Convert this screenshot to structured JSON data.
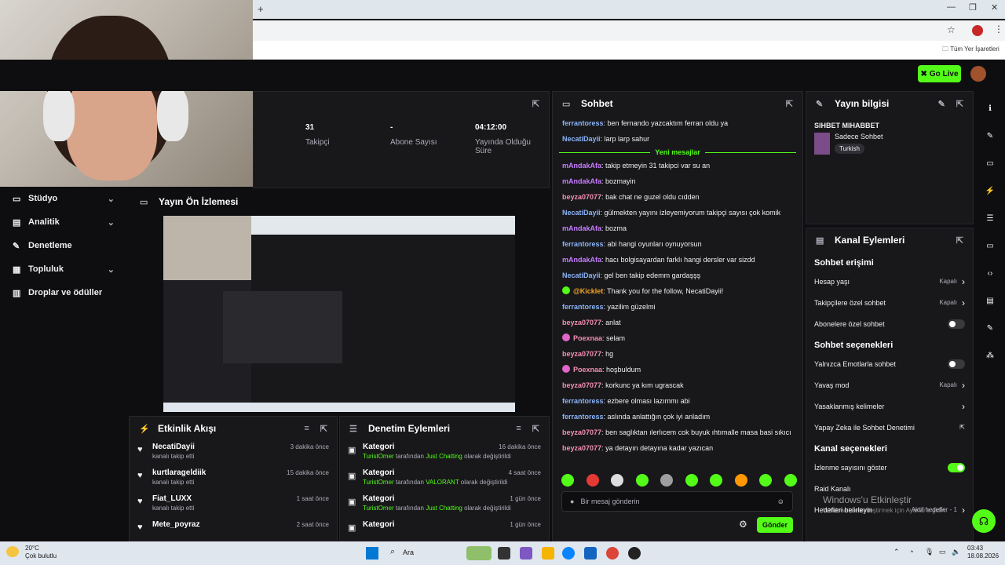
{
  "browser": {
    "new_tab": "+",
    "bookmarks_label": "Tüm Yer İşaretleri"
  },
  "header": {
    "go_live": "Go Live"
  },
  "stats": {
    "followers_value": "31",
    "followers_label": "Takipçi",
    "subs_value": "-",
    "subs_label": "Abone Sayısı",
    "uptime_value": "04:12:00",
    "uptime_label": "Yayında Olduğu Süre"
  },
  "sidebar": {
    "items": [
      {
        "label": "Stüdyo",
        "icon": "studio-icon",
        "chevron": true
      },
      {
        "label": "Analitik",
        "icon": "analytics-icon",
        "chevron": true
      },
      {
        "label": "Denetleme",
        "icon": "wrench-icon",
        "chevron": false
      },
      {
        "label": "Topluluk",
        "icon": "community-icon",
        "chevron": true
      },
      {
        "label": "Droplar ve ödüller",
        "icon": "drops-icon",
        "chevron": false
      }
    ]
  },
  "preview": {
    "title": "Yayın Ön İzlemesi"
  },
  "activity": {
    "title": "Etkinlik Akışı",
    "items": [
      {
        "name": "NecatiDayii",
        "sub": "kanalı takip etti",
        "time": "3 dakika önce"
      },
      {
        "name": "kurtlarageldiik",
        "sub": "kanalı takip etti",
        "time": "15 dakika önce"
      },
      {
        "name": "Fiat_LUXX",
        "sub": "kanalı takip etti",
        "time": "1 saat önce"
      },
      {
        "name": "Mete_poyraz",
        "sub": "",
        "time": "2 saat önce"
      }
    ]
  },
  "moderation": {
    "title": "Denetim Eylemleri",
    "items": [
      {
        "name": "Kategori",
        "user": "TuristOmer",
        "mid": " tarafından ",
        "cat": "Just Chatting",
        "end": " olarak değiştirildi",
        "time": "16 dakika önce"
      },
      {
        "name": "Kategori",
        "user": "TuristOmer",
        "mid": " tarafından ",
        "cat": "VALORANT",
        "end": " olarak değiştirildi",
        "time": "4 saat önce"
      },
      {
        "name": "Kategori",
        "user": "TuristOmer",
        "mid": " tarafından ",
        "cat": "Just Chatting",
        "end": " olarak değiştirildi",
        "time": "1 gün önce"
      },
      {
        "name": "Kategori",
        "user": "",
        "mid": "",
        "cat": "",
        "end": "",
        "time": "1 gün önce"
      }
    ]
  },
  "chat": {
    "title": "Sohbet",
    "new_messages": "Yeni mesajlar",
    "before": [
      {
        "user": "ferrantoress",
        "color": "#8ab4f8",
        "text": "ben fernando yazcaktım ferran oldu ya"
      },
      {
        "user": "NecatiDayii",
        "color": "#8ab4f8",
        "text": "larp larp sahur"
      }
    ],
    "messages": [
      {
        "user": "mAndakAfa",
        "color": "#c77dff",
        "text": "takip etmeyin 31 takipci var su an",
        "badge": ""
      },
      {
        "user": "mAndakAfa",
        "color": "#c77dff",
        "text": "bozmayin",
        "badge": ""
      },
      {
        "user": "beyza07077",
        "color": "#f48fb1",
        "text": "bak chat ne guzel oldu cıdden",
        "badge": ""
      },
      {
        "user": "NecatiDayii",
        "color": "#8ab4f8",
        "text": "gülmekten yayını izleyemiyorum takipçi sayısı çok komik",
        "badge": ""
      },
      {
        "user": "mAndakAfa",
        "color": "#c77dff",
        "text": "bozma",
        "badge": ""
      },
      {
        "user": "ferrantoress",
        "color": "#8ab4f8",
        "text": "abi hangi oyunları oynuyorsun",
        "badge": ""
      },
      {
        "user": "mAndakAfa",
        "color": "#c77dff",
        "text": "hacı bolgisayardan farklı hangi dersler var sizdd",
        "badge": ""
      },
      {
        "user": "NecatiDayii",
        "color": "#8ab4f8",
        "text": "gel ben takip edemm gardaşşş",
        "badge": ""
      },
      {
        "user": "@Kicklet",
        "color": "#f5a623",
        "text": "Thank you for the follow, NecatiDayii!",
        "badge": "bot"
      },
      {
        "user": "ferrantoress",
        "color": "#8ab4f8",
        "text": "yazilim güzelmi",
        "badge": ""
      },
      {
        "user": "beyza07077",
        "color": "#f48fb1",
        "text": "anlat",
        "badge": ""
      },
      {
        "user": "Poexnaa",
        "color": "#f48fb1",
        "text": "selam",
        "badge": "sub"
      },
      {
        "user": "beyza07077",
        "color": "#f48fb1",
        "text": "hg",
        "badge": ""
      },
      {
        "user": "Poexnaa",
        "color": "#f48fb1",
        "text": "hoşbuldum",
        "badge": "sub"
      },
      {
        "user": "beyza07077",
        "color": "#f48fb1",
        "text": "korkunc ya kım ugrascak",
        "badge": ""
      },
      {
        "user": "ferrantoress",
        "color": "#8ab4f8",
        "text": "ezbere olması lazımmı abi",
        "badge": ""
      },
      {
        "user": "ferrantoress",
        "color": "#8ab4f8",
        "text": "aslında anlattığın çok iyi anladım",
        "badge": ""
      },
      {
        "user": "beyza07077",
        "color": "#f48fb1",
        "text": "ben saglıktan ılerlıcem cok buyuk ıhtımalle masa basi sıkıcı",
        "badge": ""
      },
      {
        "user": "beyza07077",
        "color": "#f48fb1",
        "text": "ya detayın detayına kadar yazıcan",
        "badge": ""
      }
    ],
    "input_placeholder": "Bir mesaj gönderin",
    "send_label": "Gönder"
  },
  "info": {
    "title": "Yayın bilgisi",
    "stream_title": "SIHBET MIHABBET",
    "category": "Sadece Sohbet",
    "tag": "Turkish"
  },
  "actions": {
    "title": "Kanal Eylemleri",
    "sections": [
      {
        "heading": "Sohbet erişimi",
        "rows": [
          {
            "label": "Hesap yaşı",
            "value": "Kapalı",
            "kind": "chevron"
          },
          {
            "label": "Takipçilere özel sohbet",
            "value": "Kapalı",
            "kind": "chevron"
          },
          {
            "label": "Abonelere özel sohbet",
            "value": "",
            "kind": "toggle-off"
          }
        ]
      },
      {
        "heading": "Sohbet seçenekleri",
        "rows": [
          {
            "label": "Yalnızca Emotlarla sohbet",
            "value": "",
            "kind": "toggle-off"
          },
          {
            "label": "Yavaş mod",
            "value": "Kapalı",
            "kind": "chevron"
          },
          {
            "label": "Yasaklanmış kelimeler",
            "value": "",
            "kind": "chevron"
          },
          {
            "label": "Yapay Zeka ile Sohbet Denetimi",
            "value": "",
            "kind": "external"
          }
        ]
      },
      {
        "heading": "Kanal seçenekleri",
        "rows": [
          {
            "label": "İzlenme sayısını göster",
            "value": "",
            "kind": "toggle-on"
          },
          {
            "label": "Raid Kanalı",
            "value": "",
            "kind": "none"
          },
          {
            "label": "Hedefleri belirleyin",
            "value": "Aktif hedefler - 1",
            "kind": "chevron"
          }
        ]
      }
    ]
  },
  "watermark": {
    "line1": "Windows'u Etkinleştir",
    "line2": "Windows'u etkinleştirmek için Ayarlar'a gidin."
  },
  "taskbar": {
    "temp": "20°C",
    "weather": "Çok bulutlu",
    "search": "Ara",
    "time": "03:43",
    "date": "18.08.2026"
  },
  "colors": {
    "accent": "#53fc18",
    "panel": "#18181b",
    "bg": "#0e0e10"
  }
}
